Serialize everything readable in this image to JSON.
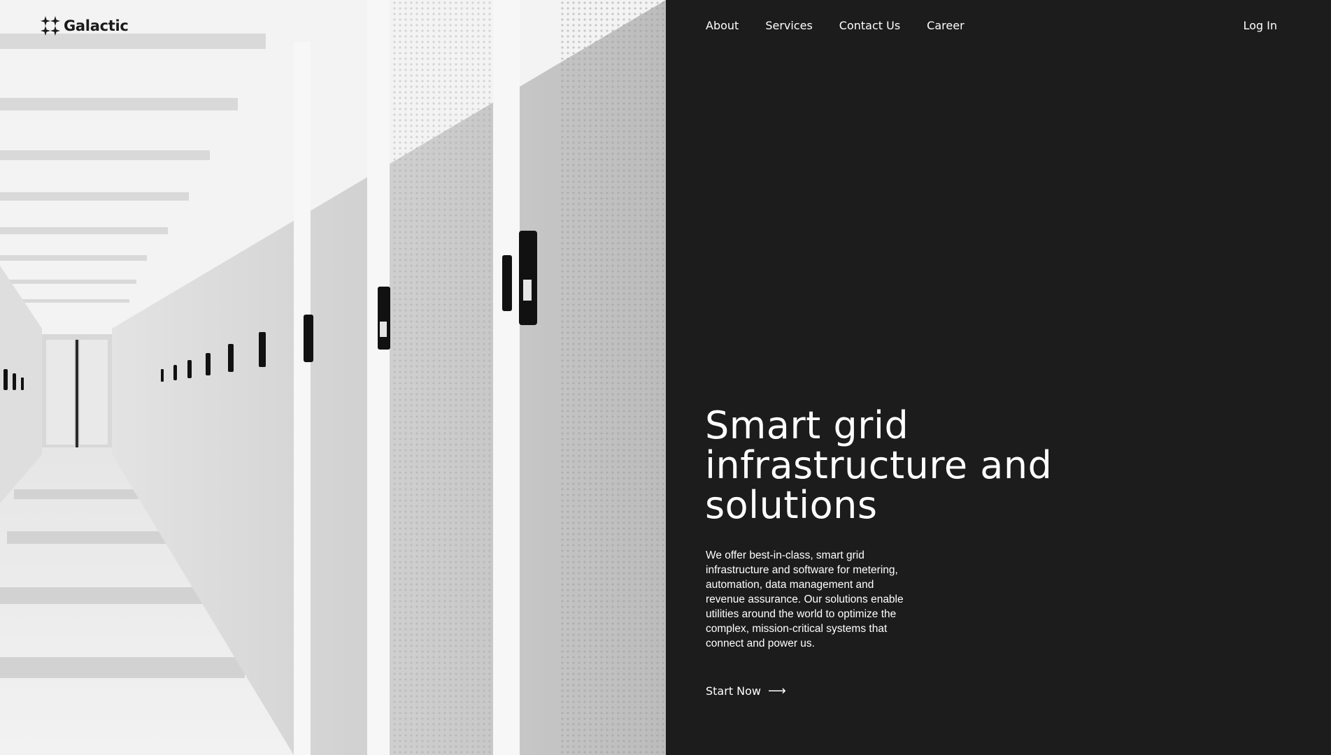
{
  "brand": {
    "name": "Galactic",
    "logo_icon": "sparkle-cluster-icon"
  },
  "nav": {
    "items": [
      {
        "label": "About"
      },
      {
        "label": "Services"
      },
      {
        "label": "Contact Us"
      },
      {
        "label": "Career"
      }
    ],
    "login_label": "Log In"
  },
  "hero": {
    "headline_lines": [
      "Smart grid",
      "infrastructure and",
      "solutions"
    ],
    "lead": "We offer best-in-class, smart grid infrastructure and software for metering, automation, data management and revenue assurance. Our solutions enable utilities around the world to optimize the complex, mission-critical systems that connect and power us.",
    "cta_label": "Start Now",
    "cta_icon": "arrow-right-icon"
  },
  "colors": {
    "dark_panel": "#1c1c1c",
    "text_light": "#ffffff",
    "text_dark": "#1a1a1a"
  }
}
